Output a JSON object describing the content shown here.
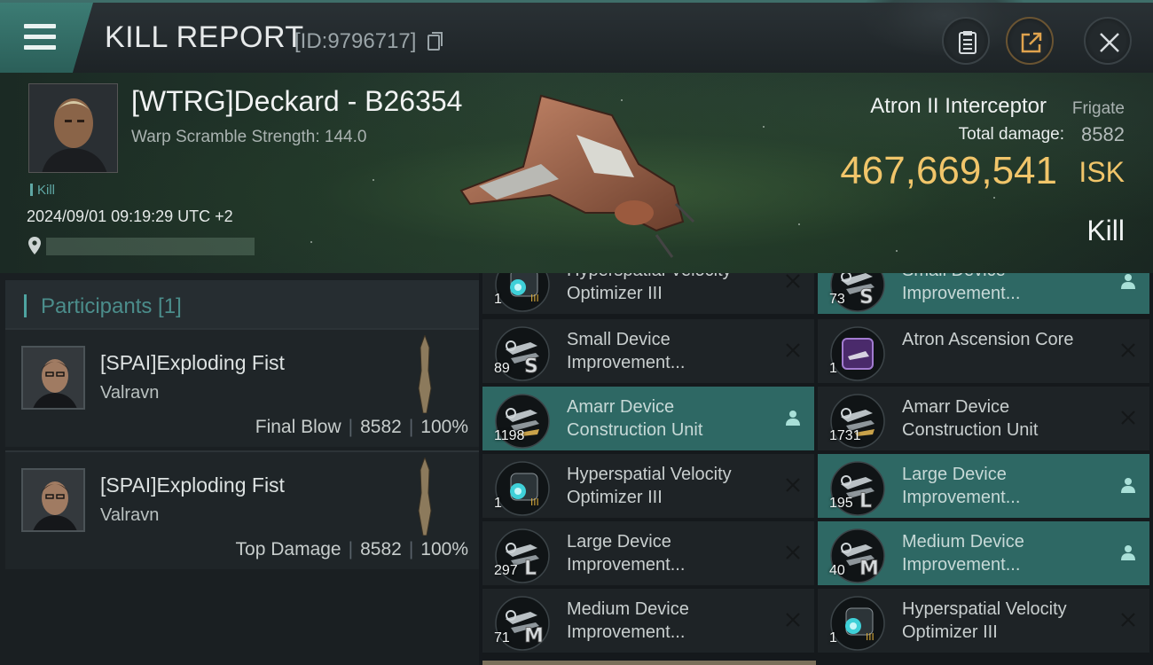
{
  "header": {
    "title": "KILL REPORT",
    "report_id": "[ID:9796717]"
  },
  "victim": {
    "name": "[WTRG]Deckard - B26354",
    "warp_scramble": "Warp Scramble Strength: 144.0",
    "kill_tag": "Kill",
    "timestamp": "2024/09/01 09:19:29 UTC +2",
    "ship_name": "Atron II Interceptor",
    "ship_class": "Frigate",
    "damage_label": "Total damage:",
    "damage_value": "8582",
    "isk_value": "467,669,541",
    "isk_unit": "ISK",
    "result": "Kill"
  },
  "participants": {
    "title": "Participants [1]",
    "rows": [
      {
        "name": "[SPAI]Exploding Fist",
        "corp": "Valravn",
        "role": "Final Blow",
        "damage": "8582",
        "percent": "100%"
      },
      {
        "name": "[SPAI]Exploding Fist",
        "corp": "Valravn",
        "role": "Top Damage",
        "damage": "8582",
        "percent": "100%"
      }
    ]
  },
  "items": [
    {
      "name": "Hyperspatial Velocity Optimizer III",
      "qty": "1",
      "icon": "hyperspatial-optimizer-icon",
      "dropped": false
    },
    {
      "name": "Small Device Improvement...",
      "qty": "73",
      "icon": "small-device-icon",
      "dropped": true
    },
    {
      "name": "Small Device Improvement...",
      "qty": "89",
      "icon": "small-device-icon",
      "dropped": false
    },
    {
      "name": "Atron Ascension Core",
      "qty": "1",
      "icon": "ascension-core-icon",
      "dropped": false
    },
    {
      "name": "Amarr Device Construction Unit",
      "qty": "1198",
      "icon": "amarr-device-icon",
      "dropped": true
    },
    {
      "name": "Amarr Device Construction Unit",
      "qty": "1731",
      "icon": "amarr-device-icon",
      "dropped": false
    },
    {
      "name": "Hyperspatial Velocity Optimizer III",
      "qty": "1",
      "icon": "hyperspatial-optimizer-icon",
      "dropped": false
    },
    {
      "name": "Large Device Improvement...",
      "qty": "195",
      "icon": "large-device-icon",
      "dropped": true
    },
    {
      "name": "Large Device Improvement...",
      "qty": "297",
      "icon": "large-device-icon",
      "dropped": false
    },
    {
      "name": "Medium Device Improvement...",
      "qty": "40",
      "icon": "medium-device-icon",
      "dropped": true
    },
    {
      "name": "Medium Device Improvement...",
      "qty": "71",
      "icon": "medium-device-icon",
      "dropped": false
    },
    {
      "name": "Hyperspatial Velocity Optimizer III",
      "qty": "1",
      "icon": "hyperspatial-optimizer-icon",
      "dropped": false
    }
  ],
  "colors": {
    "accent_teal": "#4ea4a1",
    "dropped_bg": "#2e6864",
    "isk_gold": "#f1c56a"
  }
}
